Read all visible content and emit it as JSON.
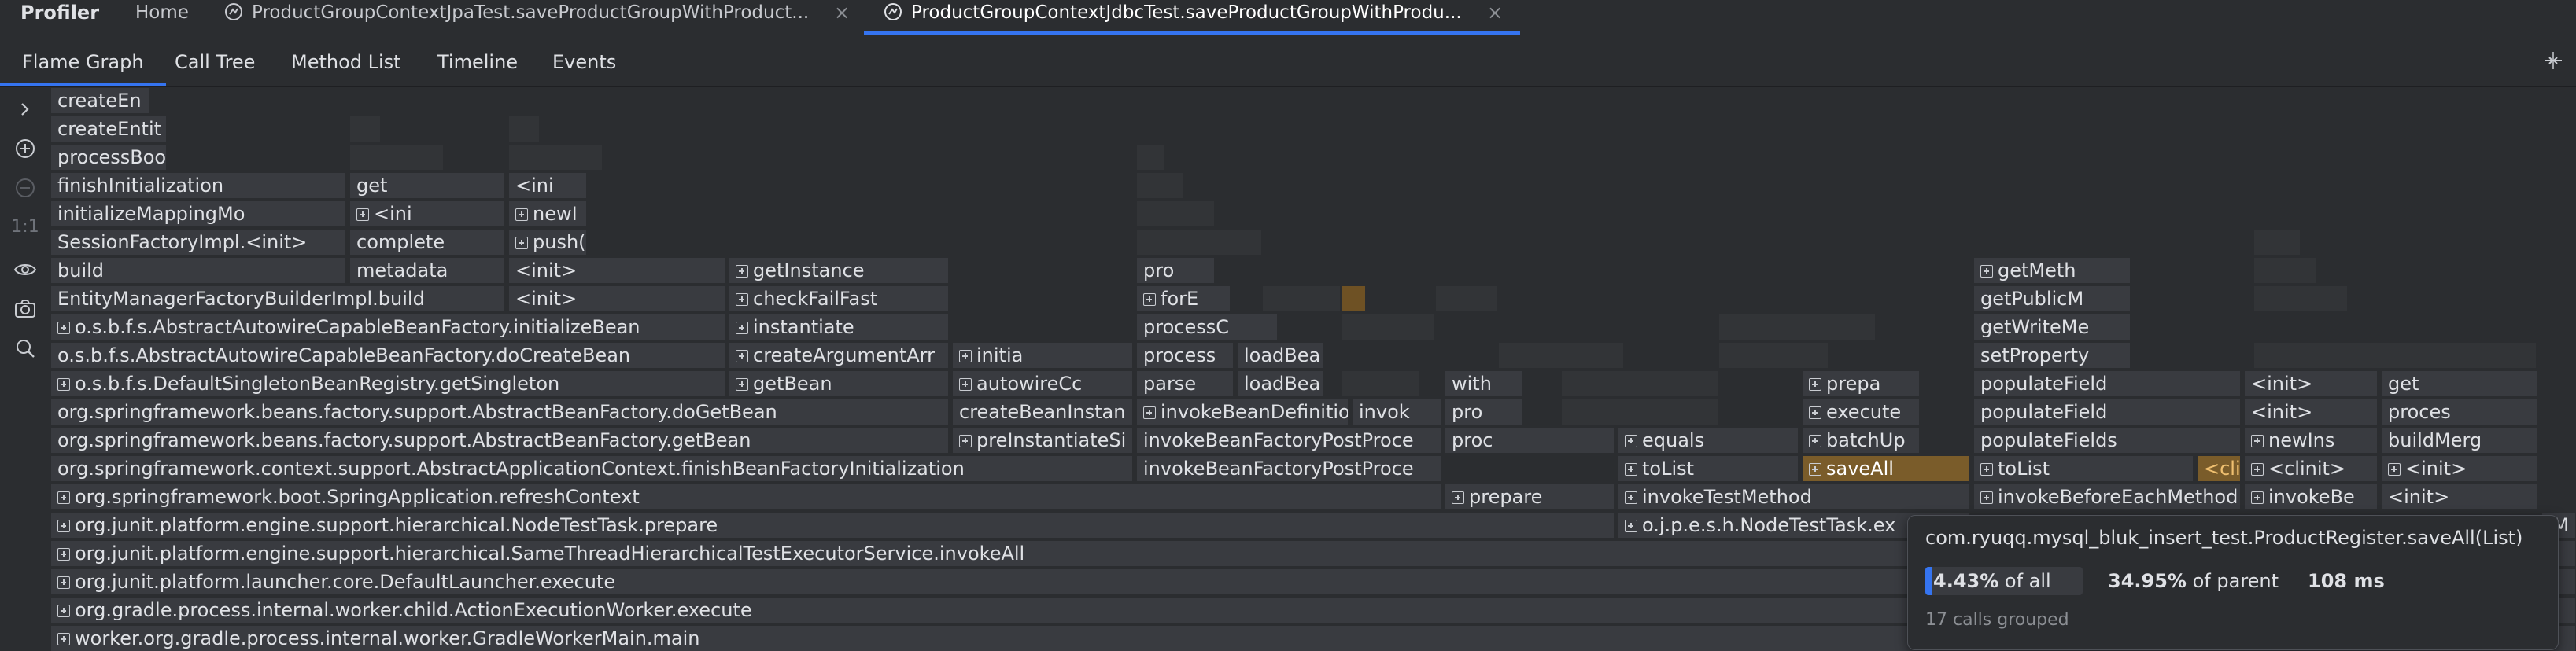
{
  "app": {
    "title": "Profiler"
  },
  "session_tabs": [
    {
      "label": "Home"
    },
    {
      "label": "ProductGroupContextJpaTest.saveProductGroupWithProduct..."
    },
    {
      "label": "ProductGroupContextJdbcTest.saveProductGroupWithProdu..."
    }
  ],
  "view_tabs": [
    "Flame Graph",
    "Call Tree",
    "Method List",
    "Timeline",
    "Events"
  ],
  "toolstrip": {
    "actual_size": "1:1",
    "icons": [
      "chevron-right-icon",
      "zoom-in-icon",
      "zoom-out-icon",
      "eye-icon",
      "camera-icon",
      "search-icon"
    ]
  },
  "frames": {
    "r0": [
      "createEn"
    ],
    "r1": [
      "createEntit"
    ],
    "r2": [
      "processBoo"
    ],
    "r3": [
      "finishInitialization",
      "get",
      "<ini"
    ],
    "r4": [
      "initializeMappingMo",
      "<ini",
      "newI"
    ],
    "r5": [
      "SessionFactoryImpl.<init>",
      "complete",
      "push("
    ],
    "r6": [
      "build",
      "metadata",
      "<init>",
      "getInstance",
      "pro",
      "getMeth"
    ],
    "r7": [
      "EntityManagerFactoryBuilderImpl.build",
      "<init>",
      "checkFailFast",
      "forE",
      "getPublicM"
    ],
    "r8": [
      "o.s.b.f.s.AbstractAutowireCapableBeanFactory.initializeBean",
      "instantiate",
      "processC",
      "getWriteMe"
    ],
    "r9": [
      "o.s.b.f.s.AbstractAutowireCapableBeanFactory.doCreateBean",
      "createArgumentArr",
      "initia",
      "process",
      "loadBea",
      "setProperty"
    ],
    "r10": [
      "o.s.b.f.s.DefaultSingletonBeanRegistry.getSingleton",
      "getBean",
      "autowireCc",
      "parse",
      "loadBea",
      "with",
      "prepa",
      "populateField",
      "<init>",
      "get"
    ],
    "r11": [
      "org.springframework.beans.factory.support.AbstractBeanFactory.doGetBean",
      "createBeanInstan",
      "invokeBeanDefinitio",
      "invok",
      "pro",
      "execute",
      "populateField",
      "<init>",
      "proces"
    ],
    "r12": [
      "org.springframework.beans.factory.support.AbstractBeanFactory.getBean",
      "preInstantiateSi",
      "invokeBeanFactoryPostProce",
      "proc",
      "equals",
      "batchUp",
      "populateFields",
      "newIns",
      "buildMerg"
    ],
    "r13": [
      "org.springframework.context.support.AbstractApplicationContext.finishBeanFactoryInitialization",
      "invokeBeanFactoryPostProce",
      "toList",
      "saveAll",
      "toList",
      "<cli",
      "<clinit>",
      "<init>"
    ],
    "r14": [
      "org.springframework.boot.SpringApplication.refreshContext",
      "prepare",
      "invokeTestMethod",
      "invokeBeforeEachMethod",
      "invokeBe",
      "<init>"
    ],
    "r15": [
      "org.junit.platform.engine.support.hierarchical.NodeTestTask.prepare",
      "o.j.p.e.s.h.NodeTestTask.ex",
      "tM"
    ],
    "r16": [
      "org.junit.platform.engine.support.hierarchical.SameThreadHierarchicalTestExecutorService.invokeAll"
    ],
    "r17": [
      "org.junit.platform.launcher.core.DefaultLauncher.execute"
    ],
    "r18": [
      "org.gradle.process.internal.worker.child.ActionExecutionWorker.execute"
    ],
    "r19": [
      "worker.org.gradle.process.internal.worker.GradleWorkerMain.main"
    ]
  },
  "tooltip": {
    "method": "com.ryuqq.mysql_bluk_insert_test.ProductRegister.saveAll(List)",
    "percent_of_all": "4.43%",
    "of_all_label": "of all",
    "percent_of_parent": "34.95%",
    "of_parent_label": "of parent",
    "time": "108 ms",
    "calls": "17 calls grouped",
    "fraction_of_all": 0.0443
  },
  "colors": {
    "accent": "#3574f0",
    "highlight": "#7a5c2a",
    "frame": "#393b40",
    "background": "#2b2d30"
  }
}
